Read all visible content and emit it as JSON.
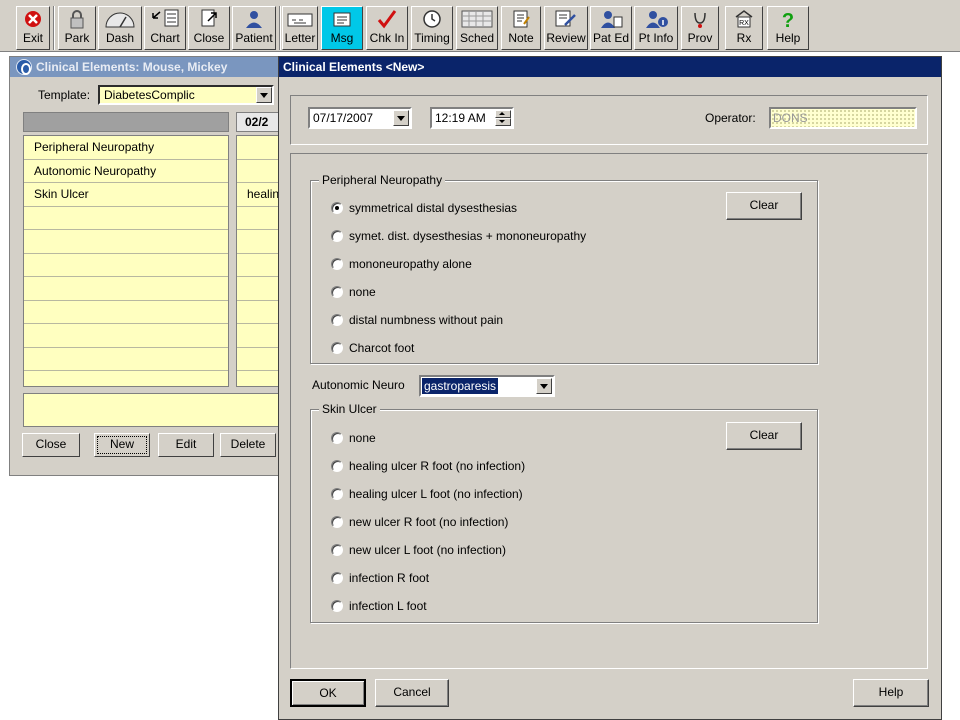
{
  "toolbar": {
    "buttons": [
      {
        "label": "Exit",
        "icon": "exit-icon"
      },
      {
        "label": "Park",
        "icon": "lock-icon"
      },
      {
        "label": "Dash",
        "icon": "dashboard-icon"
      },
      {
        "label": "Chart",
        "icon": "chart-icon"
      },
      {
        "label": "Close",
        "icon": "close-chart-icon"
      },
      {
        "label": "Patient",
        "icon": "patient-icon"
      },
      {
        "label": "Letter",
        "icon": "letter-icon"
      },
      {
        "label": "Msg",
        "icon": "message-icon"
      },
      {
        "label": "Chk In",
        "icon": "checkmark-icon"
      },
      {
        "label": "Timing",
        "icon": "clock-icon"
      },
      {
        "label": "Sched",
        "icon": "schedule-icon"
      },
      {
        "label": "Note",
        "icon": "note-icon"
      },
      {
        "label": "Review",
        "icon": "review-icon"
      },
      {
        "label": "Pat Ed",
        "icon": "patient-education-icon"
      },
      {
        "label": "Pt Info",
        "icon": "patient-info-icon"
      },
      {
        "label": "Prov",
        "icon": "provider-icon"
      },
      {
        "label": "Rx",
        "icon": "prescription-icon"
      },
      {
        "label": "Help",
        "icon": "help-icon"
      }
    ],
    "active_color": "#00c8e8"
  },
  "left_window": {
    "title": "Clinical Elements: Mouse, Mickey",
    "template_label": "Template:",
    "template_value": "DiabetesComplic",
    "column_header": "02/2",
    "rows": [
      "Peripheral Neuropathy",
      "Autonomic Neuropathy",
      "Skin Ulcer",
      "",
      "",
      "",
      "",
      "",
      "",
      ""
    ],
    "values": [
      "",
      "",
      "healin",
      "",
      "",
      "",
      "",
      "",
      "",
      ""
    ],
    "buttons": {
      "close": "Close",
      "new": "New",
      "edit": "Edit",
      "delete": "Delete"
    }
  },
  "dialog": {
    "title": "Clinical Elements <New>",
    "date": "07/17/2007",
    "time": "12:19 AM",
    "operator_label": "Operator:",
    "operator_value": "DONS",
    "peripheral": {
      "label": "Peripheral Neuropathy",
      "clear": "Clear",
      "options": [
        {
          "label": "symmetrical  distal  dysesthesias",
          "checked": true
        },
        {
          "label": "symet.  dist.  dysesthesias  +  mononeuropathy",
          "checked": false
        },
        {
          "label": "mononeuropathy alone",
          "checked": false
        },
        {
          "label": "none",
          "checked": false
        },
        {
          "label": "distal numbness without pain",
          "checked": false
        },
        {
          "label": "Charcot foot",
          "checked": false
        }
      ]
    },
    "autonomic": {
      "label": "Autonomic Neuro",
      "value": "gastroparesis"
    },
    "skin_ulcer": {
      "label": "Skin Ulcer",
      "clear": "Clear",
      "options": [
        {
          "label": "none",
          "checked": false
        },
        {
          "label": "healing ulcer R foot (no infection)",
          "checked": false
        },
        {
          "label": "healing ulcer L foot (no infection)",
          "checked": false
        },
        {
          "label": "new ulcer R foot (no infection)",
          "checked": false
        },
        {
          "label": "new ulcer L foot (no infection)",
          "checked": false
        },
        {
          "label": "infection R foot",
          "checked": false
        },
        {
          "label": "infection L foot",
          "checked": false
        }
      ]
    },
    "buttons": {
      "ok": "OK",
      "cancel": "Cancel",
      "help": "Help"
    }
  }
}
